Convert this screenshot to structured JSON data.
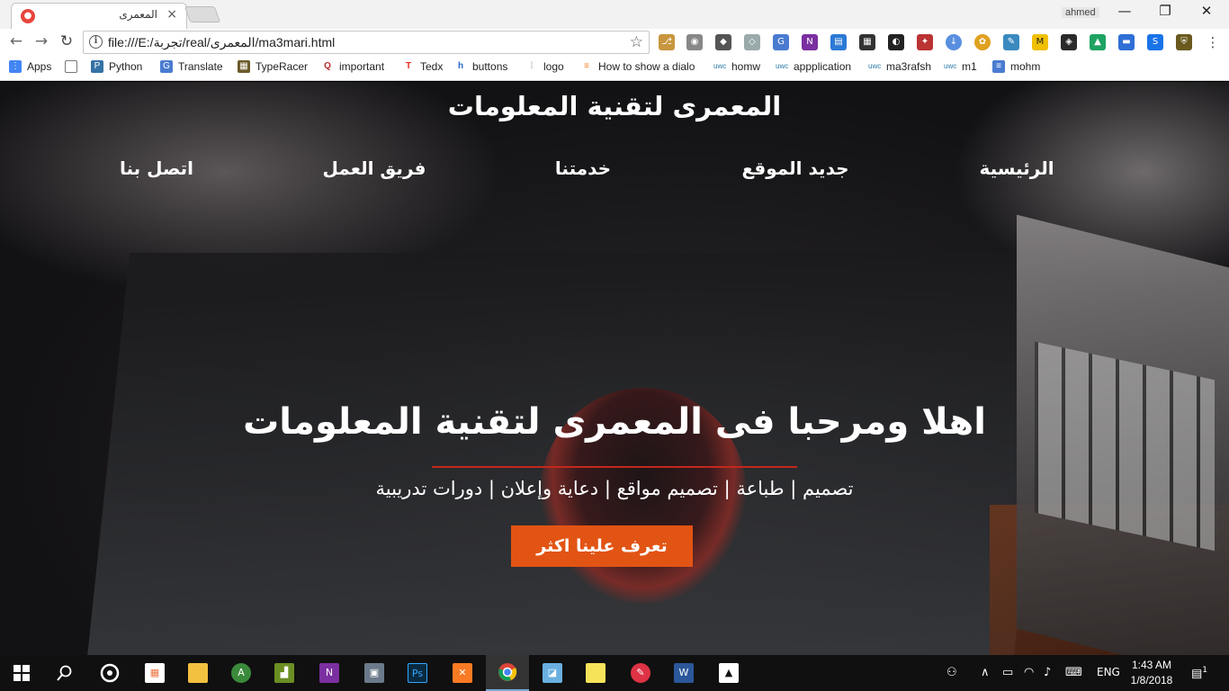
{
  "browser": {
    "tab_title": "المعمرى",
    "tab_close": "×",
    "profile_name": "ahmed",
    "url": "file:///E:/تجربة/real/المعمرى/ma3mari.html",
    "win_minimize": "—",
    "win_restore": "❐",
    "win_close": "✕",
    "nav_back": "←",
    "nav_forward": "→",
    "nav_reload": "↻",
    "star": "☆"
  },
  "bookmarks": [
    {
      "label": "Apps",
      "icon": "apps-grid-icon"
    },
    {
      "label": "",
      "icon": "page-icon"
    },
    {
      "label": "Python",
      "icon": "python-icon"
    },
    {
      "label": "Translate",
      "icon": "translate-icon"
    },
    {
      "label": "TypeRacer",
      "icon": "typeracer-icon"
    },
    {
      "label": "important",
      "icon": "quora-icon"
    },
    {
      "label": "Tedx",
      "icon": "tedx-icon"
    },
    {
      "label": "buttons",
      "icon": "buttons-icon"
    },
    {
      "label": "logo",
      "icon": "logo-grid-icon"
    },
    {
      "label": "How to show a dialo",
      "icon": "stackoverflow-icon"
    },
    {
      "label": "homw",
      "icon": "uwc-icon"
    },
    {
      "label": "appplication",
      "icon": "uwc-icon"
    },
    {
      "label": "ma3rafsh",
      "icon": "uwc-icon"
    },
    {
      "label": "m1",
      "icon": "uwc-icon"
    },
    {
      "label": "mohm",
      "icon": "docs-icon"
    }
  ],
  "page": {
    "site_title": "المعمرى لتقنية المعلومات",
    "nav": [
      "الرئيسية",
      "جديد الموقع",
      "خدمتنا",
      "فريق العمل",
      "اتصل بنا"
    ],
    "hero_title": "اهلا ومرحبا فى المعمرى لتقنية المعلومات",
    "hero_subtitle": "تصميم | طباعة | تصميم مواقع | دعاية وإعلان | دورات تدريبية",
    "cta_label": "تعرف علينا اكثر"
  },
  "taskbar": {
    "language": "ENG",
    "time": "1:43 AM",
    "date": "1/8/2018",
    "notifications": "1"
  },
  "colors": {
    "accent": "#e25414",
    "underline": "#c3271d"
  }
}
